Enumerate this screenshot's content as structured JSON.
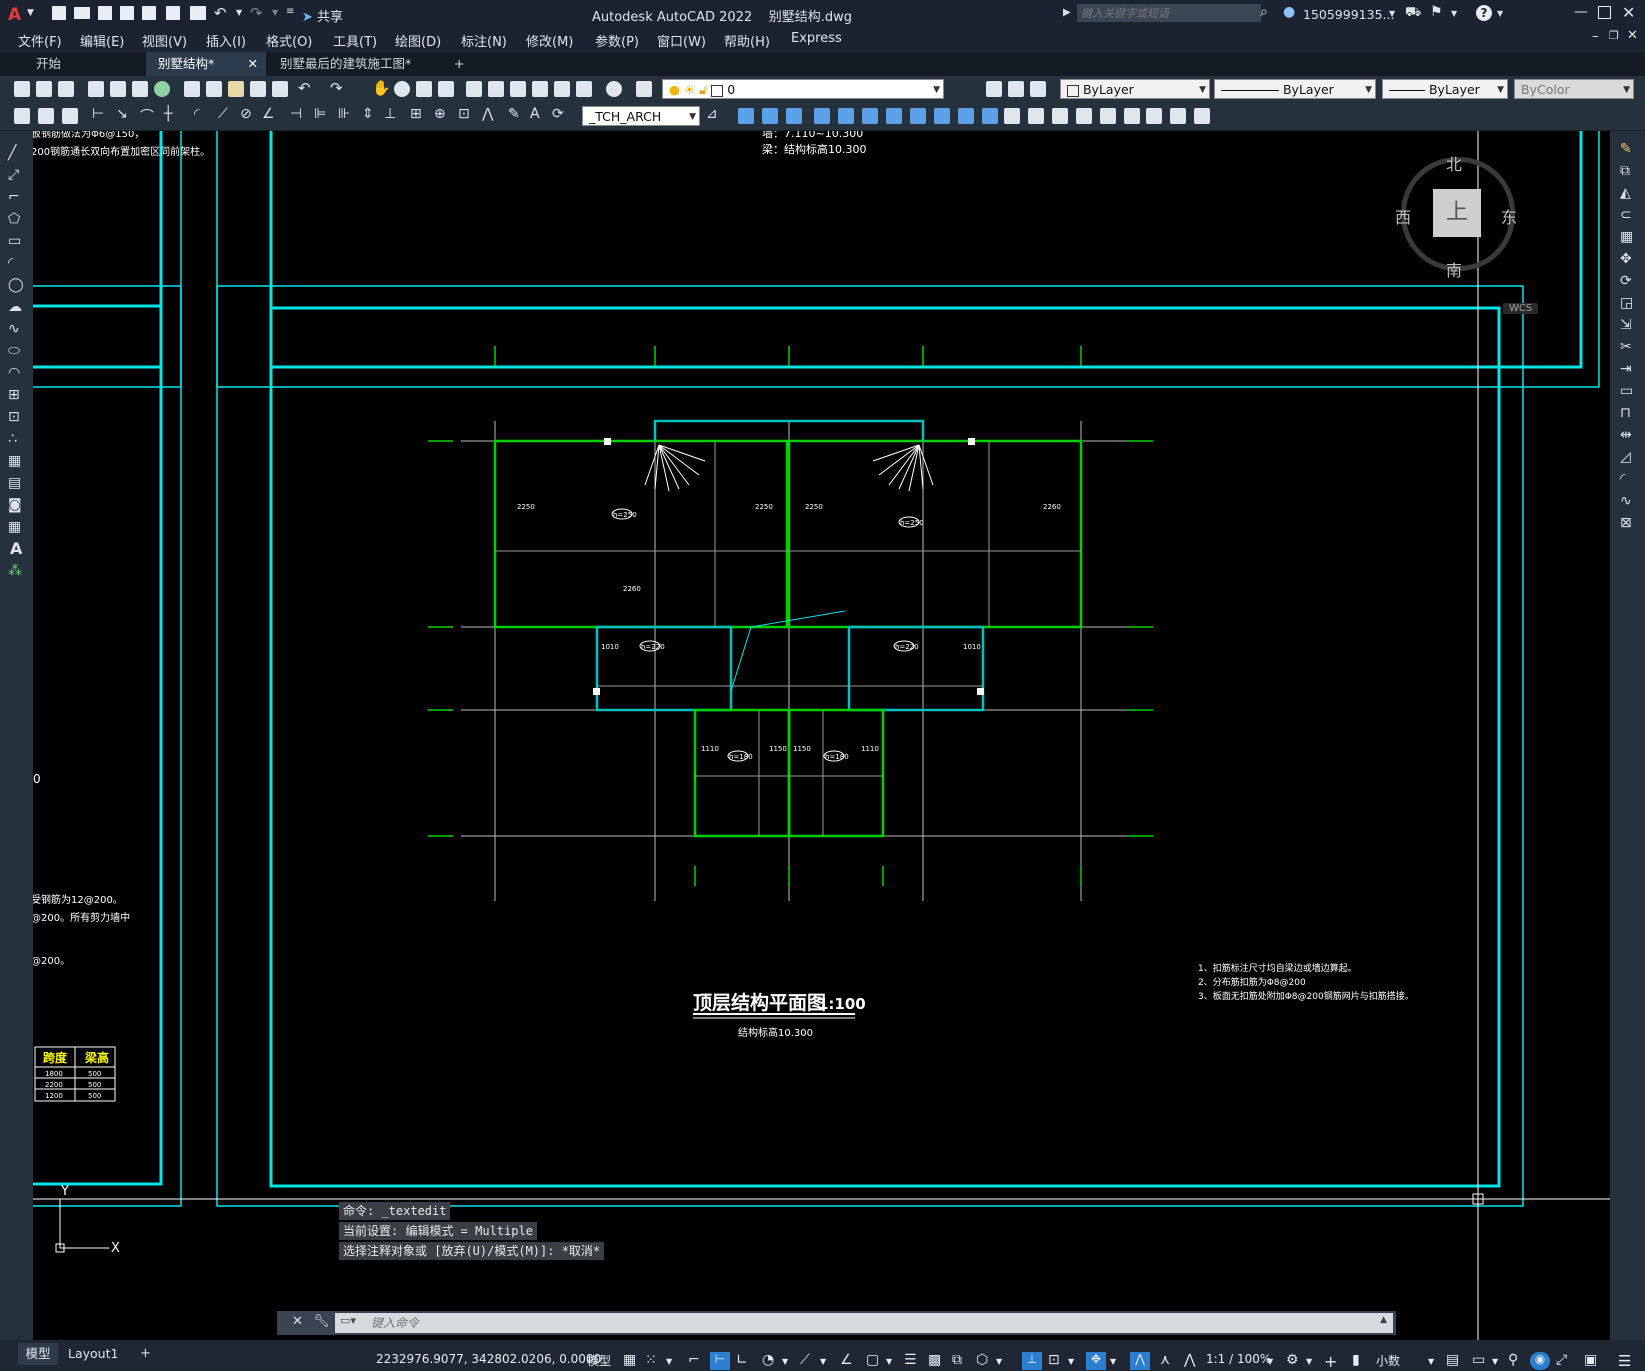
{
  "window": {
    "title": "Autodesk AutoCAD 2022    别墅结构.dwg",
    "search_placeholder": "键入关键字或短语",
    "user": "1505999135...",
    "share_label": "共享"
  },
  "menu": [
    "文件(F)",
    "编辑(E)",
    "视图(V)",
    "插入(I)",
    "格式(O)",
    "工具(T)",
    "绘图(D)",
    "标注(N)",
    "修改(M)",
    "参数(P)",
    "窗口(W)",
    "帮助(H)",
    "Express"
  ],
  "tabs": {
    "start": "开始",
    "active": "别墅结构*",
    "other": "别墅最后的建筑施工图*",
    "add": "+"
  },
  "properties": {
    "layer": "0",
    "color": "ByLayer",
    "linetype": "ByLayer",
    "lineweight": "ByLayer",
    "plotstyle": "ByColor",
    "textstyle": "_TCH_ARCH"
  },
  "viewcube": {
    "north": "北",
    "south": "南",
    "east": "东",
    "west": "西",
    "top": "上",
    "wcs": "WCS"
  },
  "drawing": {
    "top_note_1": "墙：7.110~10.300",
    "top_note_2": "梁：结构标高10.300",
    "left_note_1": "板钢筋做法为Φ6@150，",
    "left_note_2": "200钢筋通长双向布置加密区同前架柱。",
    "left_note_3": "0",
    "left_note_4": "受钢筋为12@200。",
    "left_note_5": "@200。所有剪力墙中",
    "left_note_6": "@200。",
    "table_h1": "跨度",
    "table_h2": "梁高",
    "table_rows": [
      [
        "1800",
        "500"
      ],
      [
        "2200",
        "500"
      ],
      [
        "1200",
        "500"
      ]
    ],
    "plan_title": "顶层结构平面图",
    "plan_scale": "1:100",
    "plan_subtitle": "结构标高10.300",
    "notes": [
      "1、扣筋标注尺寸均自梁边或墙边算起。",
      "2、分布筋扣筋为Φ8@200",
      "3、板面无扣筋处附加Φ8@200钢筋网片与扣筋搭接。"
    ],
    "labels": [
      "2250",
      "2250",
      "2250",
      "2260",
      "2260",
      "1010",
      "1010",
      "1110",
      "1110",
      "1150",
      "1150",
      "h=250",
      "h=250",
      "h=220",
      "h=220",
      "h=180",
      "h=180"
    ]
  },
  "ucs": {
    "x": "X",
    "y": "Y"
  },
  "command": {
    "history": [
      "命令: _textedit",
      "当前设置: 编辑模式 = Multiple",
      "选择注释对象或 [放弃(U)/模式(M)]: *取消*"
    ],
    "placeholder": "键入命令"
  },
  "layout_tabs": [
    "模型",
    "Layout1",
    "+"
  ],
  "status": {
    "coords": "2232976.9077, 342802.0206, 0.0000",
    "space": "模型",
    "scale": "1:1 / 100%",
    "units": "小数"
  }
}
